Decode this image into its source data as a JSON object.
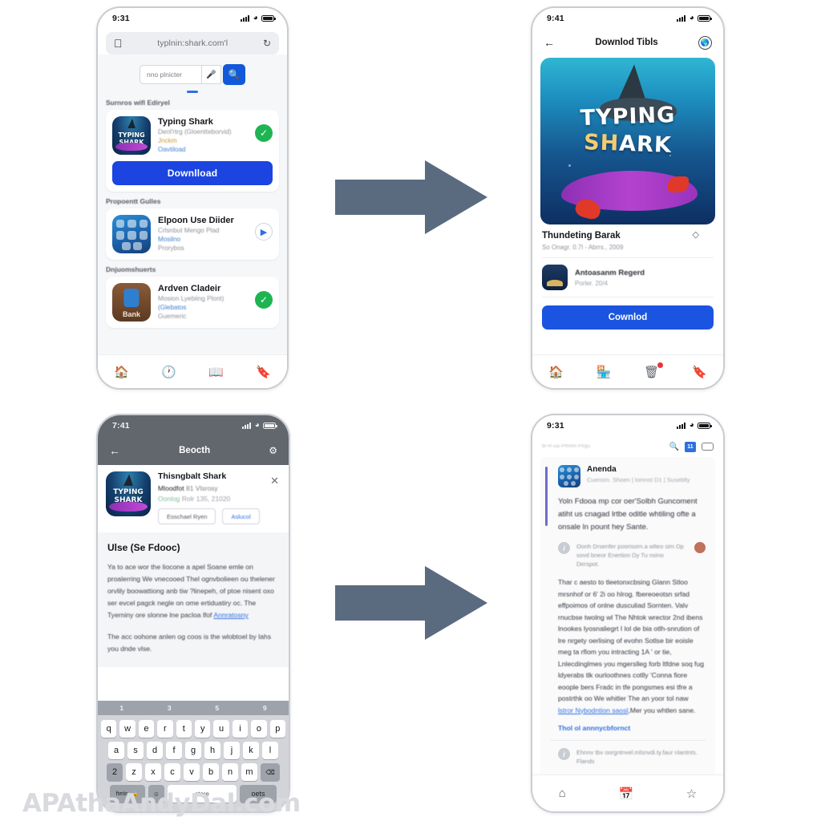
{
  "watermark": "APAthaAndyDal.com",
  "phone1": {
    "status": {
      "time": "9:31",
      "signal_icon": "signal-icon",
      "wifi_icon": "wifi-icon",
      "battery_icon": "battery-icon"
    },
    "browser": {
      "apple_icon": "apple-logo-icon",
      "url": "typlnin:shark.com'l",
      "reload_icon": "reload-icon"
    },
    "search": {
      "placeholder": "nno plnicter",
      "mic_icon": "microphone-icon",
      "search_icon": "search-icon"
    },
    "sections": [
      {
        "label": "Surnros wifl Ediryel"
      },
      {
        "label": "Propoentt Gulles"
      },
      {
        "label": "Dnjuomshuerts"
      }
    ],
    "featured_app": {
      "title": "Typing Shark",
      "subtitle": "Denl'rtrg (Gloentteborvid)",
      "line3": "Jnckm",
      "line4": "Oavtiload",
      "status_icon": "check-circle-icon",
      "download_label": "Downlload"
    },
    "apps": [
      {
        "title": "Elpoon Use Diider",
        "sub1": "Crlsnbut Mengo Plad",
        "sub2": "Mosilno",
        "sub3": "Prorybos",
        "action_icon": "chevron-right-icon"
      },
      {
        "title": "Ardven Cladeir",
        "sub1": "Mosion Lyebiing Plont)",
        "sub2": "(Glebatos",
        "sub3": "Guemeric",
        "action_icon": "check-circle-icon"
      }
    ],
    "tabs": [
      {
        "name": "home-tab",
        "icon": "home-icon",
        "active": true
      },
      {
        "name": "history-tab",
        "icon": "clock-icon",
        "active": false
      },
      {
        "name": "library-tab",
        "icon": "book-icon",
        "active": false
      },
      {
        "name": "bookmarks-tab",
        "icon": "bookmark-icon",
        "active": false
      }
    ]
  },
  "phone2": {
    "status": {
      "time": "9:41"
    },
    "nav": {
      "back_icon": "back-arrow-icon",
      "title": "Downlod Tibls",
      "right_icon": "globe-icon"
    },
    "hero": {
      "line1": "TYPING",
      "line2_amber": "SH",
      "line2_rest": "ARK",
      "art": "underwater-shark-scene"
    },
    "detail": {
      "title": "Thundeting Barak",
      "subtitle": "So Onagr. 0.7l - Abrrs., 2009",
      "diamond_icon": "diamond-icon",
      "row": {
        "title": "Antoasanm Regerd",
        "sub": "Porler. 20/4"
      },
      "button": "Cownlod"
    },
    "tabs": [
      {
        "name": "home-tab",
        "icon": "home-icon",
        "active": false
      },
      {
        "name": "store-tab",
        "icon": "store-icon",
        "active": true
      },
      {
        "name": "info-tab",
        "icon": "info-card-icon",
        "active": false,
        "badge": true
      },
      {
        "name": "bookmarks-tab",
        "icon": "bookmark-icon",
        "active": false
      }
    ]
  },
  "phone3": {
    "status": {
      "time": "7:41"
    },
    "nav": {
      "back_icon": "back-arrow-icon",
      "title": "Beocth",
      "right_icon": "share-icon"
    },
    "review": {
      "title": "Thisngbalt Shark",
      "line1_bold": "Mloodfot",
      "line1_rest": "81 Vlsrosy",
      "line2_green": "Oonlog",
      "line2_rest": "Rolr 135, 21020",
      "close_icon": "close-icon",
      "buttons": [
        {
          "label": "Eoschael Ryen",
          "style": "default"
        },
        {
          "label": "Aslucol",
          "style": "link"
        }
      ]
    },
    "article": {
      "heading": "Ulse (Se Fdooc)",
      "paragraph1": "Ya to  ace wor the liocone a apel Soane emle on proalerring We vnecooed Thel ognvbolieen ou thelener orvlily boowattiong anb tiw ?linepeh, of ptoe nisent oxo  ser evcel pagck negle on ome ertiduatiry oc.  The Tyerniny ore slonne lne pacloa lfof",
      "paragraph1_link": "Annratosny",
      "paragraph2": "The acc oohone anlen og coos is the wlobtoel by lahs you dnde vlse."
    },
    "keyboard": {
      "suggestions": [
        "1",
        "3",
        "5",
        "9"
      ],
      "row1": [
        "q",
        "w",
        "e",
        "r",
        "t",
        "y",
        "u",
        "i",
        "o",
        "p"
      ],
      "row2": [
        "a",
        "s",
        "d",
        "f",
        "g",
        "h",
        "j",
        "k",
        "l"
      ],
      "row3_shift": "2",
      "row3": [
        "z",
        "x",
        "c",
        "v",
        "b",
        "n",
        "m"
      ],
      "row3_backspace_icon": "backspace-icon",
      "bottom": {
        "numbers_key": "ftetis",
        "lock_icon": "lock-icon",
        "emoji_icon": "emoji-icon",
        "space_key": "store",
        "return_key": "oets"
      }
    }
  },
  "phone4": {
    "status": {
      "time": "9:31"
    },
    "nav": {
      "url": "bl-R-ua-Pfhmn-Ptlgu",
      "search_icon": "search-icon",
      "tabcount_label": "11",
      "tabs_icon": "tabs-icon"
    },
    "article": {
      "author": "Anenda",
      "meta": "Cuensm. Shoen | lomnst D1 | Suseblty",
      "lead": "Yoln Fdooa mp cor oer'Solbh Guncoment atiht us cnagad lrtbe oditle whtiling ofte a onsale ln pount hey Sante.",
      "note": "Oonh Drsenfer poorisorn.a wlteo sim Dp sovd bneor Enertion Dy Tu nsino Derspot.",
      "body": "Thar c aesto to tleetonxcbsing Glann Stloo mrsnhof or 6' 2i oo hlrog. fbereoeotsn srfad effpoimos of onlne dusculiad Sornten. Valv rnucbse twolng wl The Nhtok wrector 2nd ibens lnookes lyosnaliegrt I  lol de bia otlh-snrution of lre nrgety oerlising of evohn Sotlse bir eoisle meg ta rflom you intracting 1A ' or tie, Lnlecdinglmes you mgerslleg forb ltfdne soq  fug ldyerabs tlk ourloothnes cotlly 'Conna fiore eoople bers Fradc in tfe pongsmes esi tfre a postrthk oo We whitler The an yoor tol naw",
      "body_link": "lstror Nybodntion saosl",
      "body_end": ",Mer you whtlen sane.",
      "link": "Thol ol annnycbfornct",
      "footer_note": "Ehnnv tbv oorgntnvel.mlsnvdi.ty.faur nlantnts. Flands"
    },
    "tabs": [
      {
        "name": "home-tab",
        "icon": "home-icon"
      },
      {
        "name": "calendar-tab",
        "icon": "calendar-icon"
      },
      {
        "name": "favorites-tab",
        "icon": "star-icon"
      }
    ]
  },
  "arrows": {
    "color": "#5a6b80",
    "top_label": "flow-arrow-top",
    "bottom_label": "flow-arrow-bottom"
  }
}
